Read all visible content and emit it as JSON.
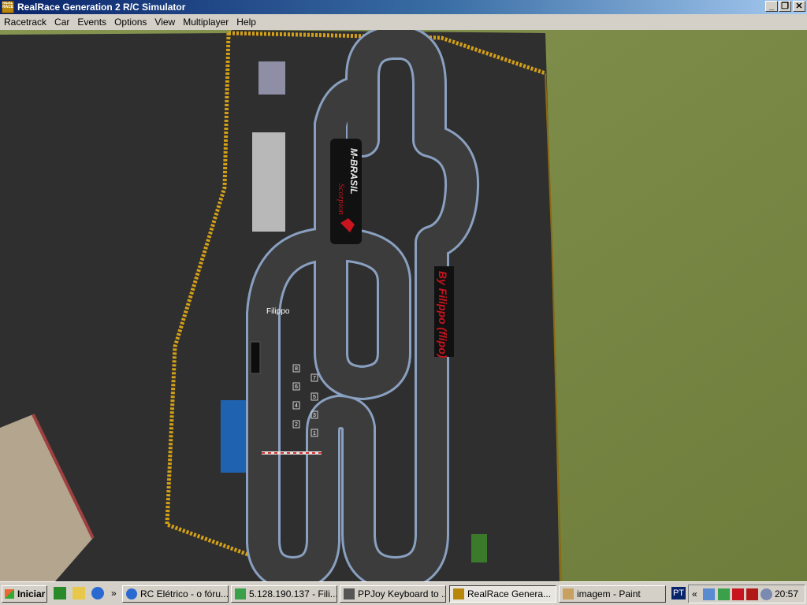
{
  "window": {
    "title": "RealRace Generation 2 R/C Simulator",
    "icon_text": "REAL RACE",
    "minimize": "_",
    "restore": "❐",
    "close": "✕"
  },
  "menu": [
    "Racetrack",
    "Car",
    "Events",
    "Options",
    "View",
    "Multiplayer",
    "Help"
  ],
  "scene": {
    "player_label": "Filippo",
    "banner_left_brand": "M-BRASIL",
    "banner_left_sub": "Scorpion",
    "banner_right": "By Filippo (flipo)",
    "grid_numbers": [
      "8",
      "7",
      "6",
      "5",
      "4",
      "3",
      "2",
      "1"
    ]
  },
  "taskbar": {
    "start_label": "Iniciar",
    "overflow": "»",
    "tasks": [
      {
        "label": "RC Elétrico - o fóru...",
        "icon": "ie-icon",
        "active": false
      },
      {
        "label": "5.128.190.137 - Fili...",
        "icon": "network-icon",
        "active": false
      },
      {
        "label": "PPJoy Keyboard to ...",
        "icon": "joystick-icon",
        "active": false
      },
      {
        "label": "RealRace Genera...",
        "icon": "realrace-icon",
        "active": true
      },
      {
        "label": "imagem - Paint",
        "icon": "paint-icon",
        "active": false
      }
    ],
    "language": "PT",
    "tray_expand": "«",
    "clock": "20:57"
  },
  "colors": {
    "title_start": "#0a246a",
    "asphalt": "#2f2f2f",
    "grass": "#7c8a48",
    "fence": "#d4a017",
    "banner_red": "#c8141e"
  }
}
